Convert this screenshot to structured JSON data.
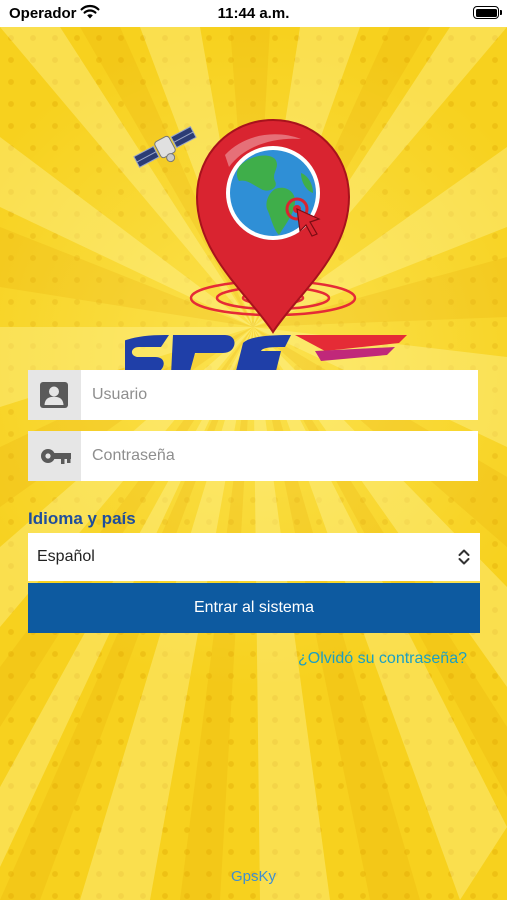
{
  "status_bar": {
    "carrier": "Operador",
    "time": "11:44 a.m.",
    "wifi_icon": "wifi-icon",
    "battery_icon": "battery-icon"
  },
  "logo": {
    "icons": [
      "satellite-icon",
      "map-pin-globe-icon",
      "cursor-arrow-icon"
    ]
  },
  "login": {
    "username": {
      "value": "",
      "placeholder": "Usuario",
      "icon": "user-icon"
    },
    "password": {
      "value": "",
      "placeholder": "Contraseña",
      "icon": "key-icon"
    },
    "language_label": "Idioma y país",
    "language_selected": "Español",
    "submit_label": "Entrar al sistema",
    "forgot_link": "¿Olvidó su contraseña?"
  },
  "footer": {
    "text": "GpsKy"
  },
  "colors": {
    "background": "#f7d11e",
    "primary_button": "#0d5aa0",
    "label": "#1f4e9c",
    "link": "#1a9fc2",
    "pin": "#e52b36"
  }
}
